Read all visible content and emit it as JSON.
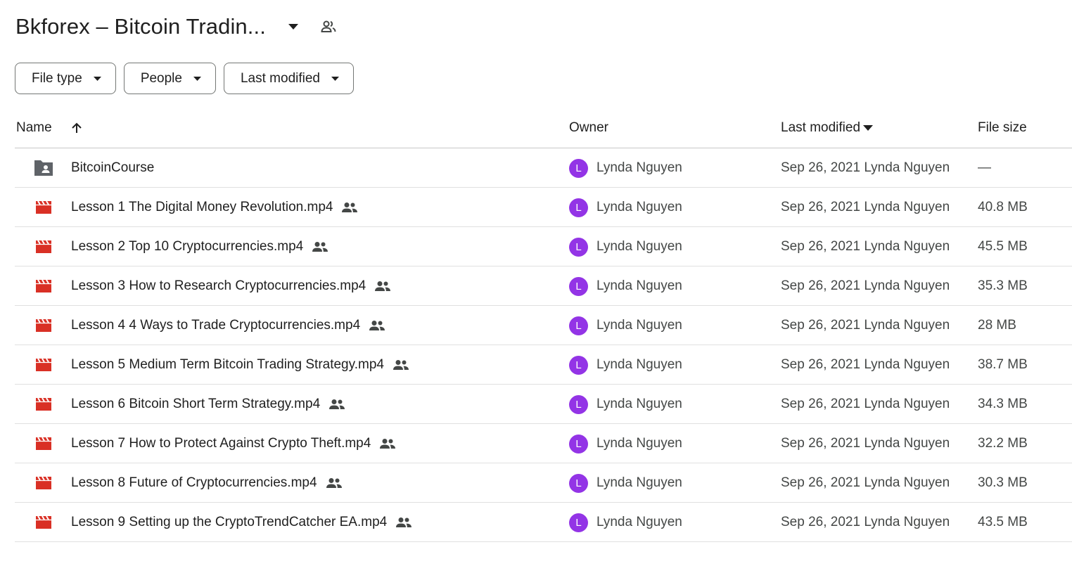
{
  "header": {
    "title": "Bkforex – Bitcoin Tradin..."
  },
  "filters": [
    {
      "label": "File type"
    },
    {
      "label": "People"
    },
    {
      "label": "Last modified"
    }
  ],
  "columns": {
    "name": "Name",
    "owner": "Owner",
    "last_modified": "Last modified",
    "file_size": "File size"
  },
  "colors": {
    "video": "#d93025",
    "folder": "#5f6368",
    "avatar": "#9334e6"
  },
  "rows": [
    {
      "type": "folder",
      "icon": "shared-folder-icon",
      "name": "BitcoinCourse",
      "shared": false,
      "owner_initial": "L",
      "owner": "Lynda Nguyen",
      "modified": "Sep 26, 2021 Lynda Nguyen",
      "size": "—"
    },
    {
      "type": "video",
      "icon": "video-file-icon",
      "name": "Lesson 1 The Digital Money Revolution.mp4",
      "shared": true,
      "owner_initial": "L",
      "owner": "Lynda Nguyen",
      "modified": "Sep 26, 2021 Lynda Nguyen",
      "size": "40.8 MB"
    },
    {
      "type": "video",
      "icon": "video-file-icon",
      "name": "Lesson 2 Top 10 Cryptocurrencies.mp4",
      "shared": true,
      "owner_initial": "L",
      "owner": "Lynda Nguyen",
      "modified": "Sep 26, 2021 Lynda Nguyen",
      "size": "45.5 MB"
    },
    {
      "type": "video",
      "icon": "video-file-icon",
      "name": "Lesson 3 How to Research Cryptocurrencies.mp4",
      "shared": true,
      "owner_initial": "L",
      "owner": "Lynda Nguyen",
      "modified": "Sep 26, 2021 Lynda Nguyen",
      "size": "35.3 MB"
    },
    {
      "type": "video",
      "icon": "video-file-icon",
      "name": "Lesson 4 4 Ways to Trade Cryptocurrencies.mp4",
      "shared": true,
      "owner_initial": "L",
      "owner": "Lynda Nguyen",
      "modified": "Sep 26, 2021 Lynda Nguyen",
      "size": "28 MB"
    },
    {
      "type": "video",
      "icon": "video-file-icon",
      "name": "Lesson 5 Medium Term Bitcoin Trading Strategy.mp4",
      "shared": true,
      "owner_initial": "L",
      "owner": "Lynda Nguyen",
      "modified": "Sep 26, 2021 Lynda Nguyen",
      "size": "38.7 MB"
    },
    {
      "type": "video",
      "icon": "video-file-icon",
      "name": "Lesson 6 Bitcoin Short Term Strategy.mp4",
      "shared": true,
      "owner_initial": "L",
      "owner": "Lynda Nguyen",
      "modified": "Sep 26, 2021 Lynda Nguyen",
      "size": "34.3 MB"
    },
    {
      "type": "video",
      "icon": "video-file-icon",
      "name": "Lesson 7 How to Protect Against Crypto Theft.mp4",
      "shared": true,
      "owner_initial": "L",
      "owner": "Lynda Nguyen",
      "modified": "Sep 26, 2021 Lynda Nguyen",
      "size": "32.2 MB"
    },
    {
      "type": "video",
      "icon": "video-file-icon",
      "name": "Lesson 8 Future of Cryptocurrencies.mp4",
      "shared": true,
      "owner_initial": "L",
      "owner": "Lynda Nguyen",
      "modified": "Sep 26, 2021 Lynda Nguyen",
      "size": "30.3 MB"
    },
    {
      "type": "video",
      "icon": "video-file-icon",
      "name": "Lesson 9 Setting up the CryptoTrendCatcher EA.mp4",
      "shared": true,
      "owner_initial": "L",
      "owner": "Lynda Nguyen",
      "modified": "Sep 26, 2021 Lynda Nguyen",
      "size": "43.5 MB"
    }
  ]
}
